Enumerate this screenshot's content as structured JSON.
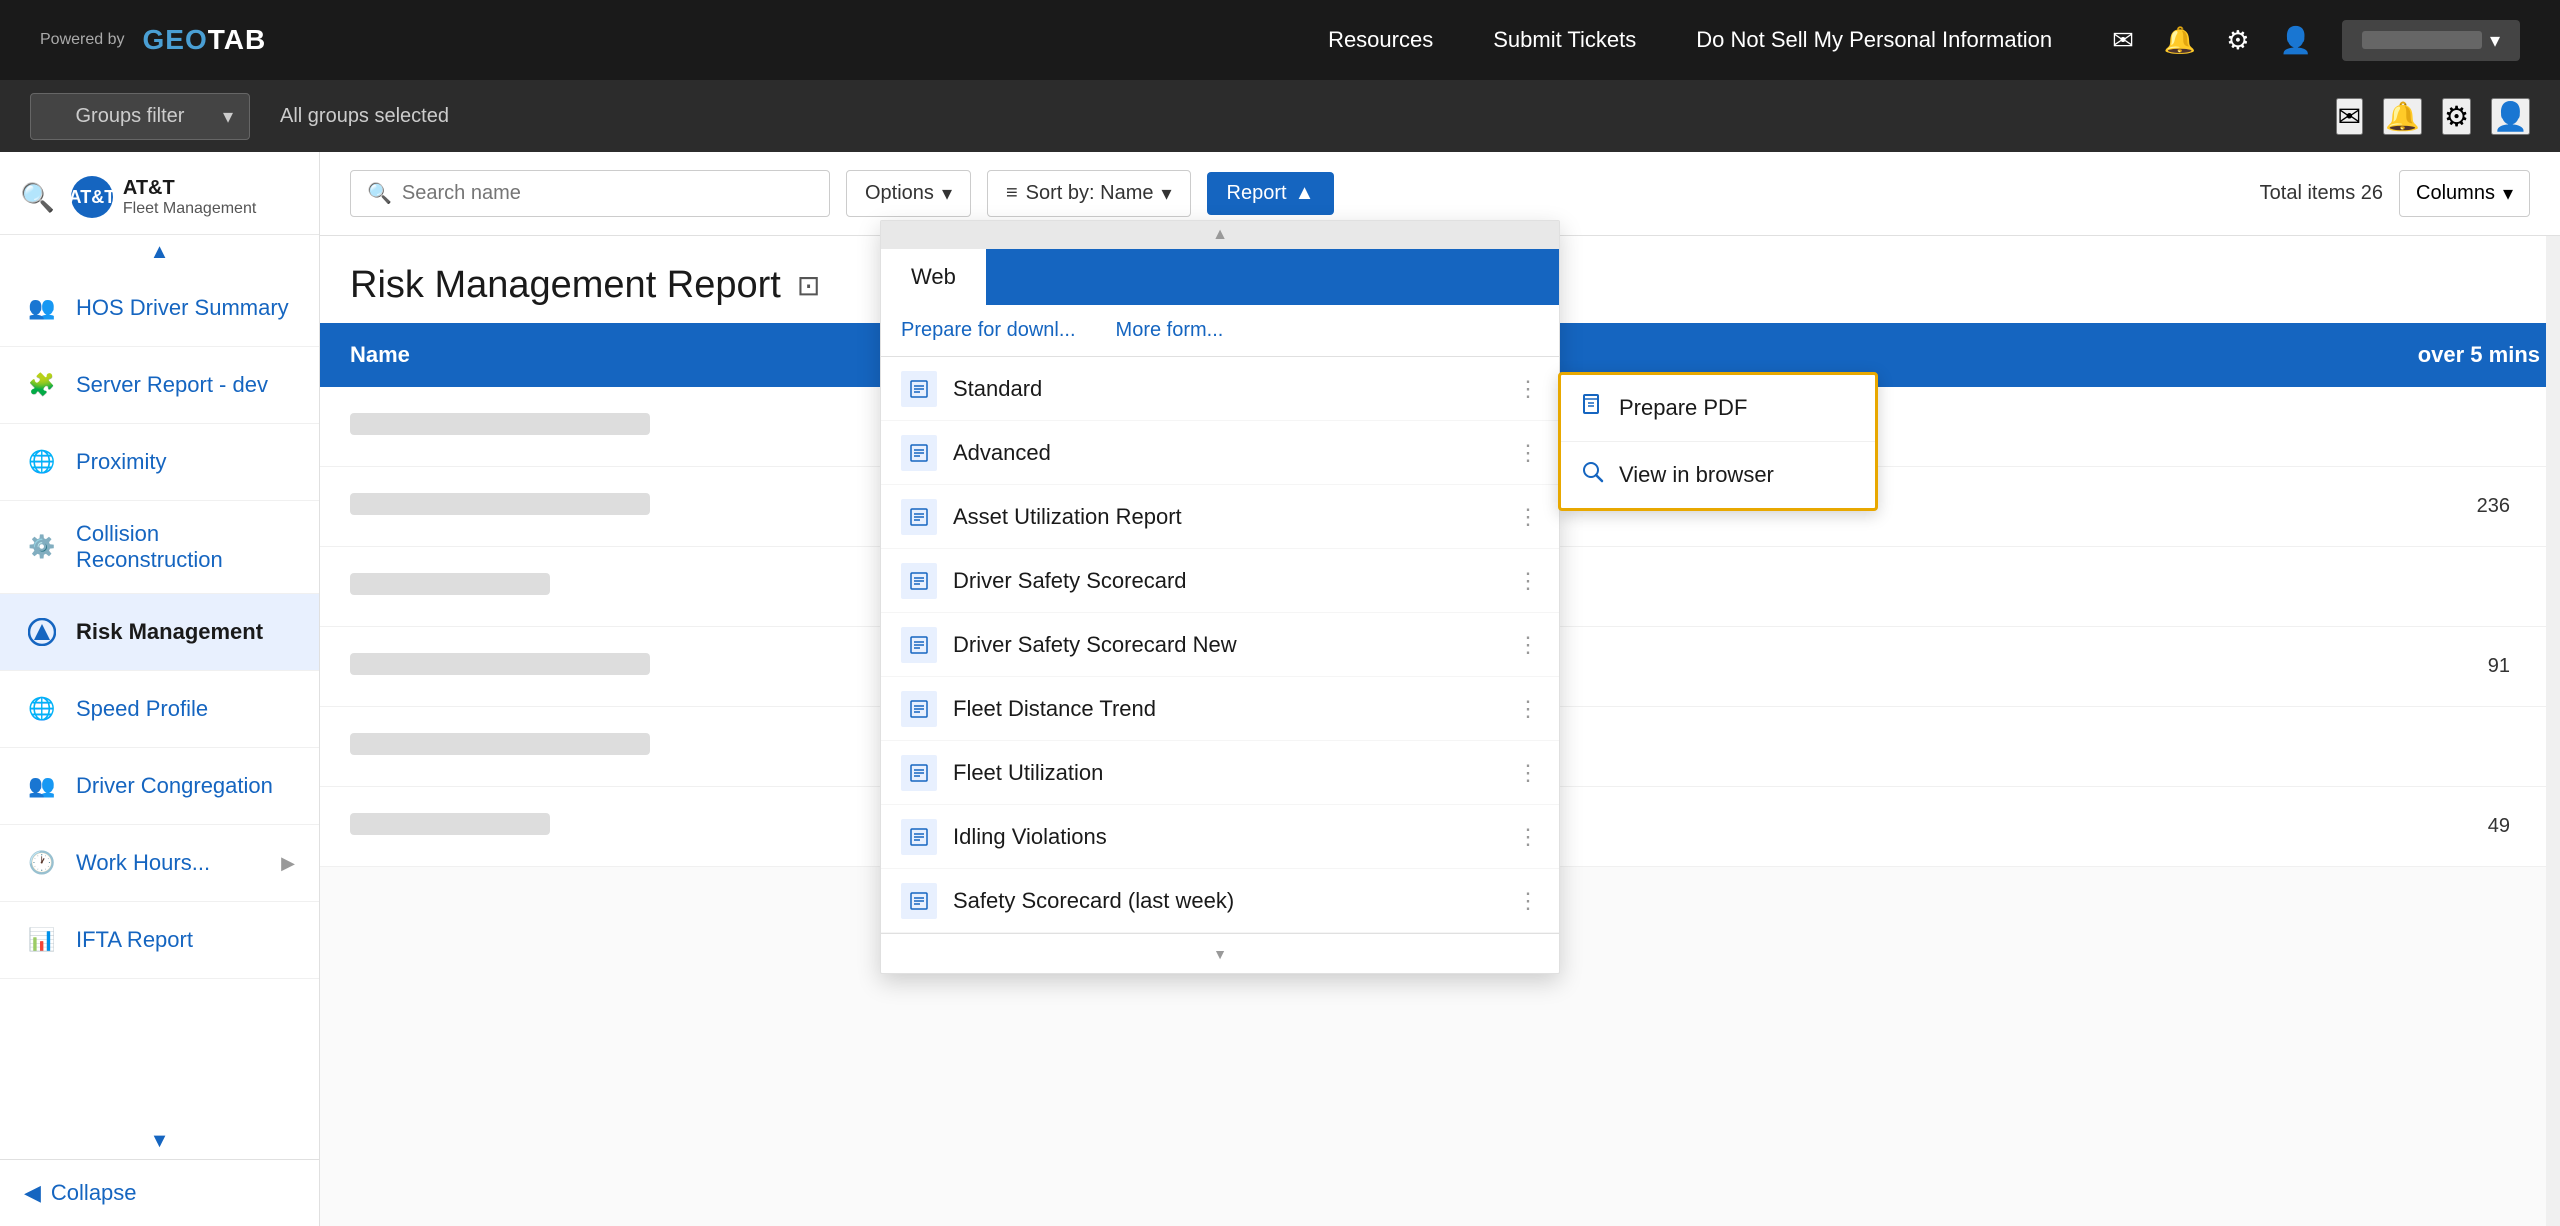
{
  "topnav": {
    "powered_by": "Powered by",
    "logo": "GEOTAB",
    "links": [
      "Resources",
      "Submit Tickets",
      "Do Not Sell My Personal Information"
    ]
  },
  "filterbar": {
    "groups_filter_label": "Groups filter",
    "all_groups": "All groups selected"
  },
  "sidebar": {
    "brand_name": "AT&T",
    "brand_sub": "Fleet Management",
    "search_placeholder": "Search",
    "items": [
      {
        "id": "hos-driver-summary",
        "label": "HOS Driver Summary",
        "icon": "👥",
        "active": false
      },
      {
        "id": "server-report-dev",
        "label": "Server Report - dev",
        "icon": "🧩",
        "active": false
      },
      {
        "id": "proximity",
        "label": "Proximity",
        "icon": "🌐",
        "active": false
      },
      {
        "id": "collision-reconstruction",
        "label": "Collision Reconstruction",
        "icon": "⚙️",
        "active": false
      },
      {
        "id": "risk-management",
        "label": "Risk Management",
        "icon": "🔷",
        "active": true
      },
      {
        "id": "speed-profile",
        "label": "Speed Profile",
        "icon": "🌐",
        "active": false
      },
      {
        "id": "driver-congregation",
        "label": "Driver Congregation",
        "icon": "👥",
        "active": false
      },
      {
        "id": "work-hours",
        "label": "Work Hours...",
        "icon": "🕐",
        "active": false,
        "has_arrow": true
      },
      {
        "id": "ifta-report",
        "label": "IFTA Report",
        "icon": "📊",
        "active": false
      }
    ],
    "collapse_label": "Collapse"
  },
  "toolbar": {
    "search_placeholder": "Search name",
    "options_label": "Options",
    "sort_label": "Sort by:  Name",
    "report_label": "Report",
    "total_items_label": "Total items 26",
    "columns_label": "Columns"
  },
  "page": {
    "title": "Risk Management Report",
    "bookmark_icon": "🔖"
  },
  "table": {
    "columns": [
      {
        "id": "name",
        "label": "Name"
      },
      {
        "id": "speed",
        "label": "over 5 mins"
      }
    ],
    "rows": [
      {
        "name": "",
        "speed": ""
      },
      {
        "name": "",
        "speed": "236"
      },
      {
        "name": "",
        "speed": ""
      },
      {
        "name": "",
        "speed": "91"
      },
      {
        "name": "",
        "speed": ""
      },
      {
        "name": "",
        "speed": "49"
      }
    ]
  },
  "dropdown": {
    "tabs": [
      {
        "id": "web",
        "label": "Web",
        "active": true
      },
      {
        "id": "other",
        "label": "",
        "active": false
      }
    ],
    "sub_actions": [
      "Prepare for downl...",
      "More form..."
    ],
    "items": [
      {
        "id": "standard",
        "label": "Standard"
      },
      {
        "id": "advanced",
        "label": "Advanced"
      },
      {
        "id": "asset-utilization",
        "label": "Asset Utilization Report"
      },
      {
        "id": "driver-safety-scorecard",
        "label": "Driver Safety Scorecard"
      },
      {
        "id": "driver-safety-scorecard-new",
        "label": "Driver Safety Scorecard New"
      },
      {
        "id": "fleet-distance-trend",
        "label": "Fleet Distance Trend"
      },
      {
        "id": "fleet-utilization",
        "label": "Fleet Utilization"
      },
      {
        "id": "idling-violations",
        "label": "Idling Violations"
      },
      {
        "id": "safety-scorecard",
        "label": "Safety Scorecard (last week)"
      }
    ]
  },
  "popup": {
    "items": [
      {
        "id": "prepare-pdf",
        "label": "Prepare PDF",
        "icon": "📄"
      },
      {
        "id": "view-browser",
        "label": "View in browser",
        "icon": "🔍"
      }
    ]
  }
}
